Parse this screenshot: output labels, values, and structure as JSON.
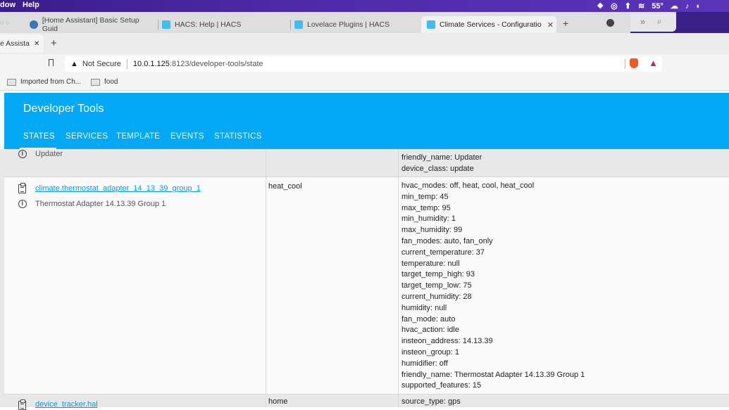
{
  "menubar": {
    "window_menu": "dow",
    "help_menu": "Help",
    "weather_temp": "55°"
  },
  "tabs": [
    {
      "label": "[Home Assistant] Basic Setup Guid"
    },
    {
      "label": "HACS: Help | HACS"
    },
    {
      "label": "Lovelace Plugins | HACS"
    },
    {
      "label": "Climate Services - Configuratio"
    }
  ],
  "back_window_tab": {
    "label": "e Assista"
  },
  "address_bar": {
    "security": "Not Secure",
    "host": "10.0.1.125",
    "path": ":8123/developer-tools/state"
  },
  "bookmarks": [
    {
      "label": "Imported from Ch..."
    },
    {
      "label": "food"
    }
  ],
  "header": {
    "title": "Developer Tools",
    "tabs": [
      {
        "label": "STATES"
      },
      {
        "label": "SERVICES"
      },
      {
        "label": "TEMPLATE"
      },
      {
        "label": "EVENTS"
      },
      {
        "label": "STATISTICS"
      }
    ]
  },
  "rows": [
    {
      "friendly": "Updater",
      "attributes": [
        "friendly_name: Updater",
        "device_class: update"
      ]
    },
    {
      "entity_id": "climate.thermostat_adapter_14_13_39_group_1",
      "friendly": "Thermostat Adapter 14.13.39 Group 1",
      "state": "heat_cool",
      "attributes": [
        "hvac_modes: off, heat, cool, heat_cool",
        "min_temp: 45",
        "max_temp: 95",
        "min_humidity: 1",
        "max_humidity: 99",
        "fan_modes: auto, fan_only",
        "current_temperature: 37",
        "temperature: null",
        "target_temp_high: 93",
        "target_temp_low: 75",
        "current_humidity: 28",
        "humidity: null",
        "fan_mode: auto",
        "hvac_action: idle",
        "insteon_address: 14.13.39",
        "insteon_group: 1",
        "humidifier: off",
        "friendly_name: Thermostat Adapter 14.13.39 Group 1",
        "supported_features: 15"
      ]
    },
    {
      "entity_id": "device_tracker.hal",
      "state": "home",
      "attributes": [
        "source_type: gps"
      ]
    }
  ]
}
